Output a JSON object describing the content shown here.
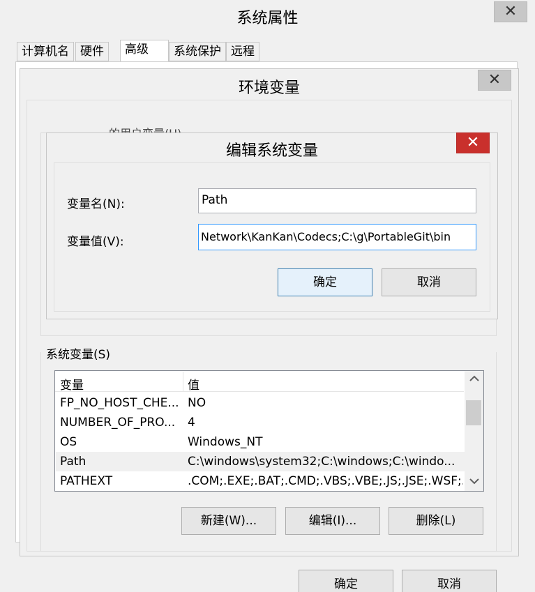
{
  "outer": {
    "title": "系统属性",
    "close": "✕",
    "tabs": [
      {
        "label": "计算机名"
      },
      {
        "label": "硬件"
      },
      {
        "label": "高级"
      },
      {
        "label": "系统保护"
      },
      {
        "label": "远程"
      }
    ],
    "ok_label": "确定",
    "cancel_label": "取消"
  },
  "env": {
    "title": "环境变量",
    "close": "✕",
    "user_vars_label": "的用户变量(U)",
    "sys_vars_label": "系统变量(S)",
    "columns": [
      "变量",
      "值"
    ],
    "rows": [
      {
        "name": "FP_NO_HOST_CHE...",
        "value": "NO"
      },
      {
        "name": "NUMBER_OF_PRO...",
        "value": "4"
      },
      {
        "name": "OS",
        "value": "Windows_NT"
      },
      {
        "name": "Path",
        "value": "C:\\windows\\system32;C:\\windows;C:\\windo..."
      },
      {
        "name": "PATHEXT",
        "value": ".COM;.EXE;.BAT;.CMD;.VBS;.VBE;.JS;.JSE;.WSF;..."
      }
    ],
    "selected_row": "Path",
    "new_label": "新建(W)...",
    "edit_label": "编辑(I)...",
    "delete_label": "删除(L)",
    "ok_label": "确定",
    "cancel_label": "取消"
  },
  "edit": {
    "title": "编辑系统变量",
    "close": "✕",
    "name_label": "变量名(N):",
    "name_value": "Path",
    "value_label": "变量值(V):",
    "value_value": "Network\\KanKan\\Codecs;C:\\g\\PortableGit\\bin",
    "ok_label": "确定",
    "cancel_label": "取消"
  },
  "colors": {
    "close_red": "#c9302c",
    "focus_blue": "#3399ff"
  }
}
